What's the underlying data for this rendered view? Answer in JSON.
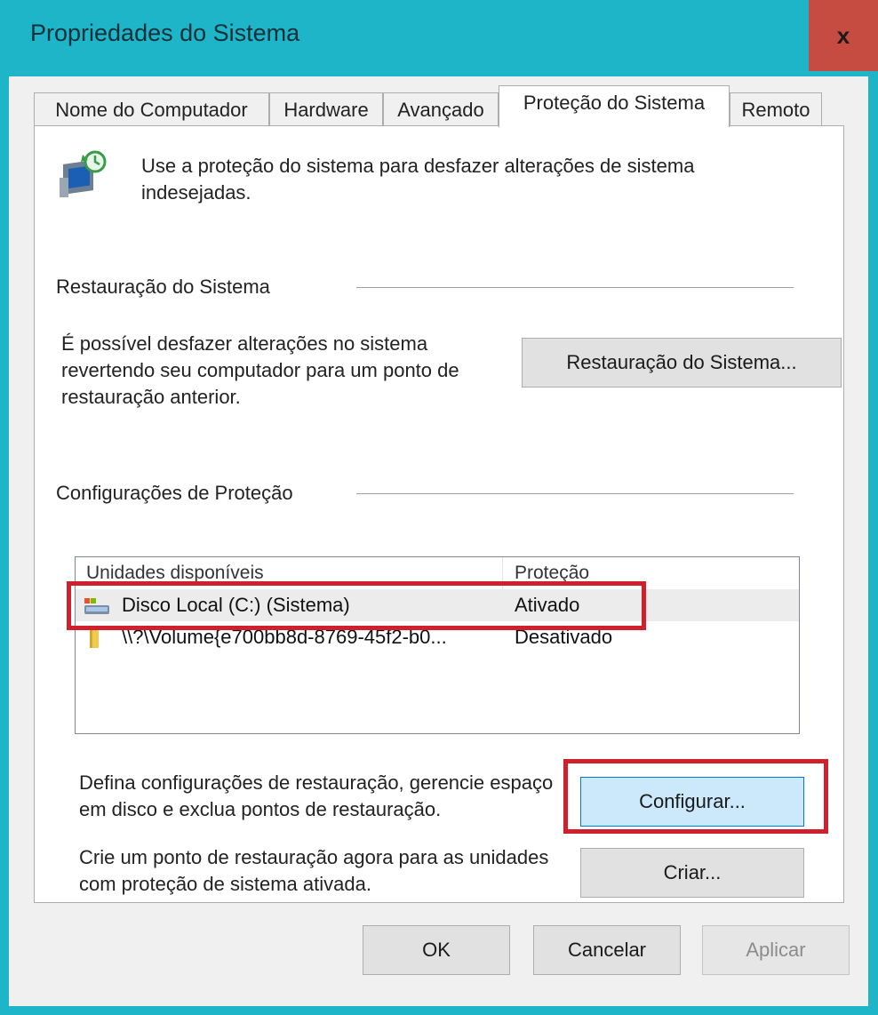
{
  "window": {
    "title": "Propriedades do Sistema",
    "close_label": "x"
  },
  "tabs": [
    {
      "label": "Nome do Computador",
      "active": false
    },
    {
      "label": "Hardware",
      "active": false
    },
    {
      "label": "Avançado",
      "active": false
    },
    {
      "label": "Proteção do Sistema",
      "active": true
    },
    {
      "label": "Remoto",
      "active": false
    }
  ],
  "intro": {
    "icon": "system-protection-icon",
    "text": "Use a proteção do sistema para desfazer alterações de sistema indesejadas."
  },
  "restore_section": {
    "title": "Restauração do Sistema",
    "description": "É possível desfazer alterações no sistema revertendo seu computador para um ponto de restauração anterior.",
    "button_label": "Restauração do Sistema..."
  },
  "protection_section": {
    "title": "Configurações de Proteção",
    "columns": [
      "Unidades disponíveis",
      "Proteção"
    ],
    "drives": [
      {
        "name": "Disco Local (C:) (Sistema)",
        "protection": "Ativado",
        "icon": "system-drive-icon",
        "selected": true
      },
      {
        "name": "\\\\?\\Volume{e700bb8d-8769-45f2-b0...",
        "protection": "Desativado",
        "icon": "volume-folder-icon",
        "selected": false
      }
    ],
    "configure_text": "Defina configurações de restauração, gerencie espaço em disco e exclua pontos de restauração.",
    "configure_button": "Configurar...",
    "create_text": "Crie um ponto de restauração agora para as unidades com proteção de sistema ativada.",
    "create_button": "Criar..."
  },
  "footer": {
    "ok": "OK",
    "cancel": "Cancelar",
    "apply": "Aplicar"
  },
  "colors": {
    "titlebar": "#1fb5c8",
    "close": "#c64b40",
    "highlight": "#d0202e"
  }
}
